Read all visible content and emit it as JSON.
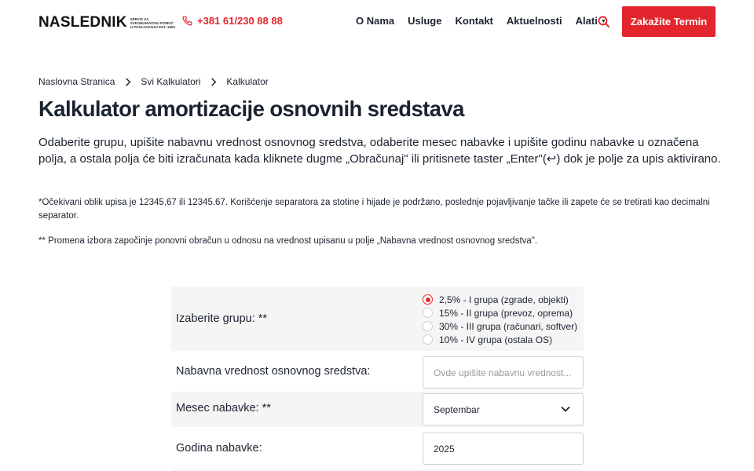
{
  "header": {
    "logo_text": "NASLEDNIK",
    "logo_tagline": "SERVIS ZA SVEOBUHVATNU POMOĆ U POSLOVANJU EST. 1993",
    "phone": "+381 61/230 88 88",
    "nav": [
      {
        "label": "O Nama"
      },
      {
        "label": "Usluge"
      },
      {
        "label": "Kontakt"
      },
      {
        "label": "Aktuelnosti"
      },
      {
        "label": "Alati"
      }
    ],
    "cta_label": "Zakažite Termin",
    "accent_color": "#e3262d"
  },
  "breadcrumb": [
    "Naslovna Stranica",
    "Svi Kalkulatori",
    "Kalkulator"
  ],
  "page_title": "Kalkulator amortizacije osnovnih sredstava",
  "intro": "Odaberite grupu, upišite nabavnu vrednost osnovnog sredstva, odaberite mesec nabavke i upišite godinu nabavke u označena polja, a ostala polja će biti izračunata kada kliknete dugme „Obračunaj\" ili pritisnete taster „Enter\"(↩) dok je polje za upis aktivirano.",
  "note1": "*Očekivani oblik upisa je 12345,67 ili 12345.67. Korišćenje separatora za stotine i hijade je podržano, poslednje pojavljivanje tačke ili zapete će se tretirati kao decimalni separator.",
  "note2": "** Promena izbora započinje ponovni obračun u odnosu na vrednost upisanu u polje „Nabavna vrednost osnovnog sredstva\".",
  "form": {
    "group_label": "Izaberite grupu: **",
    "group_options": [
      {
        "label": "2,5% - I grupa (zgrade, objekti)",
        "selected": true
      },
      {
        "label": "15% - II grupa (prevoz, oprema)",
        "selected": false
      },
      {
        "label": "30% - III grupa (računari, softver)",
        "selected": false
      },
      {
        "label": "10% - IV grupa (ostala OS)",
        "selected": false
      }
    ],
    "value_label": "Nabavna vrednost osnovnog sredstva:",
    "value_placeholder": "Ovde upišite nabavnu vrednost...",
    "month_label": "Mesec nabavke: **",
    "month_value": "Septembar",
    "year_label": "Godina nabavke:",
    "year_value": "2025"
  }
}
